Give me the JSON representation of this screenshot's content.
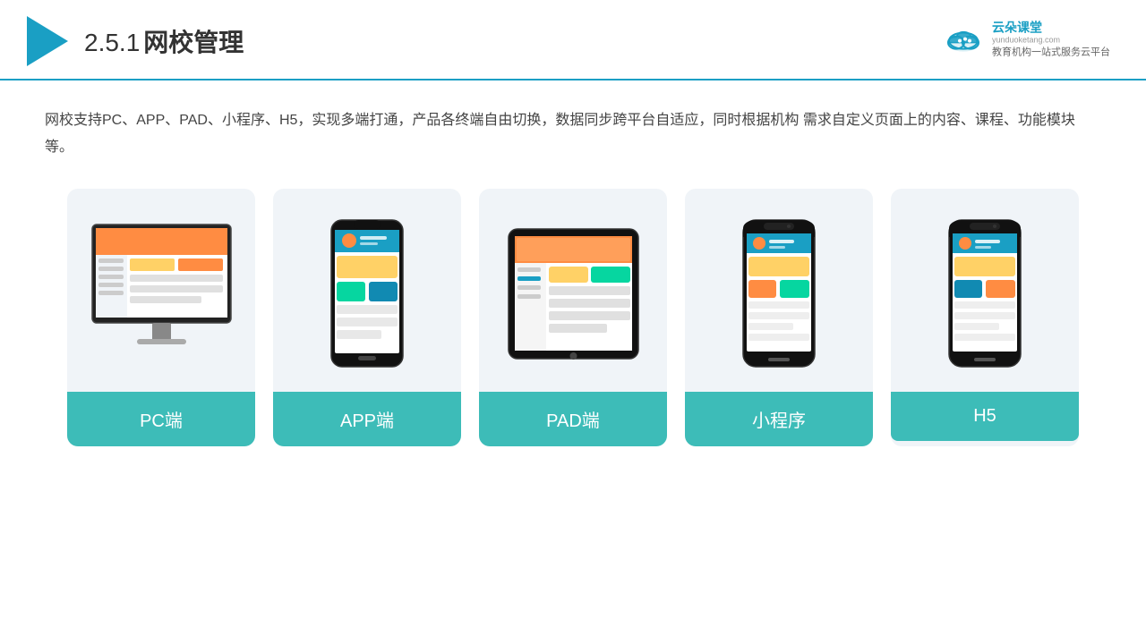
{
  "header": {
    "section_number": "2.5.1",
    "title": "网校管理",
    "brand_name": "云朵课堂",
    "brand_url": "yunduoketang.com",
    "brand_slogan": "教育机构一站\n式服务云平台"
  },
  "description": "网校支持PC、APP、PAD、小程序、H5，实现多端打通，产品各终端自由切换，数据同步跨平台自适应，同时根据机构\n需求自定义页面上的内容、课程、功能模块等。",
  "cards": [
    {
      "id": "pc",
      "label": "PC端"
    },
    {
      "id": "app",
      "label": "APP端"
    },
    {
      "id": "pad",
      "label": "PAD端"
    },
    {
      "id": "miniprogram",
      "label": "小程序"
    },
    {
      "id": "h5",
      "label": "H5"
    }
  ],
  "accent_color": "#3dbcb8",
  "header_line_color": "#1a9fc4"
}
